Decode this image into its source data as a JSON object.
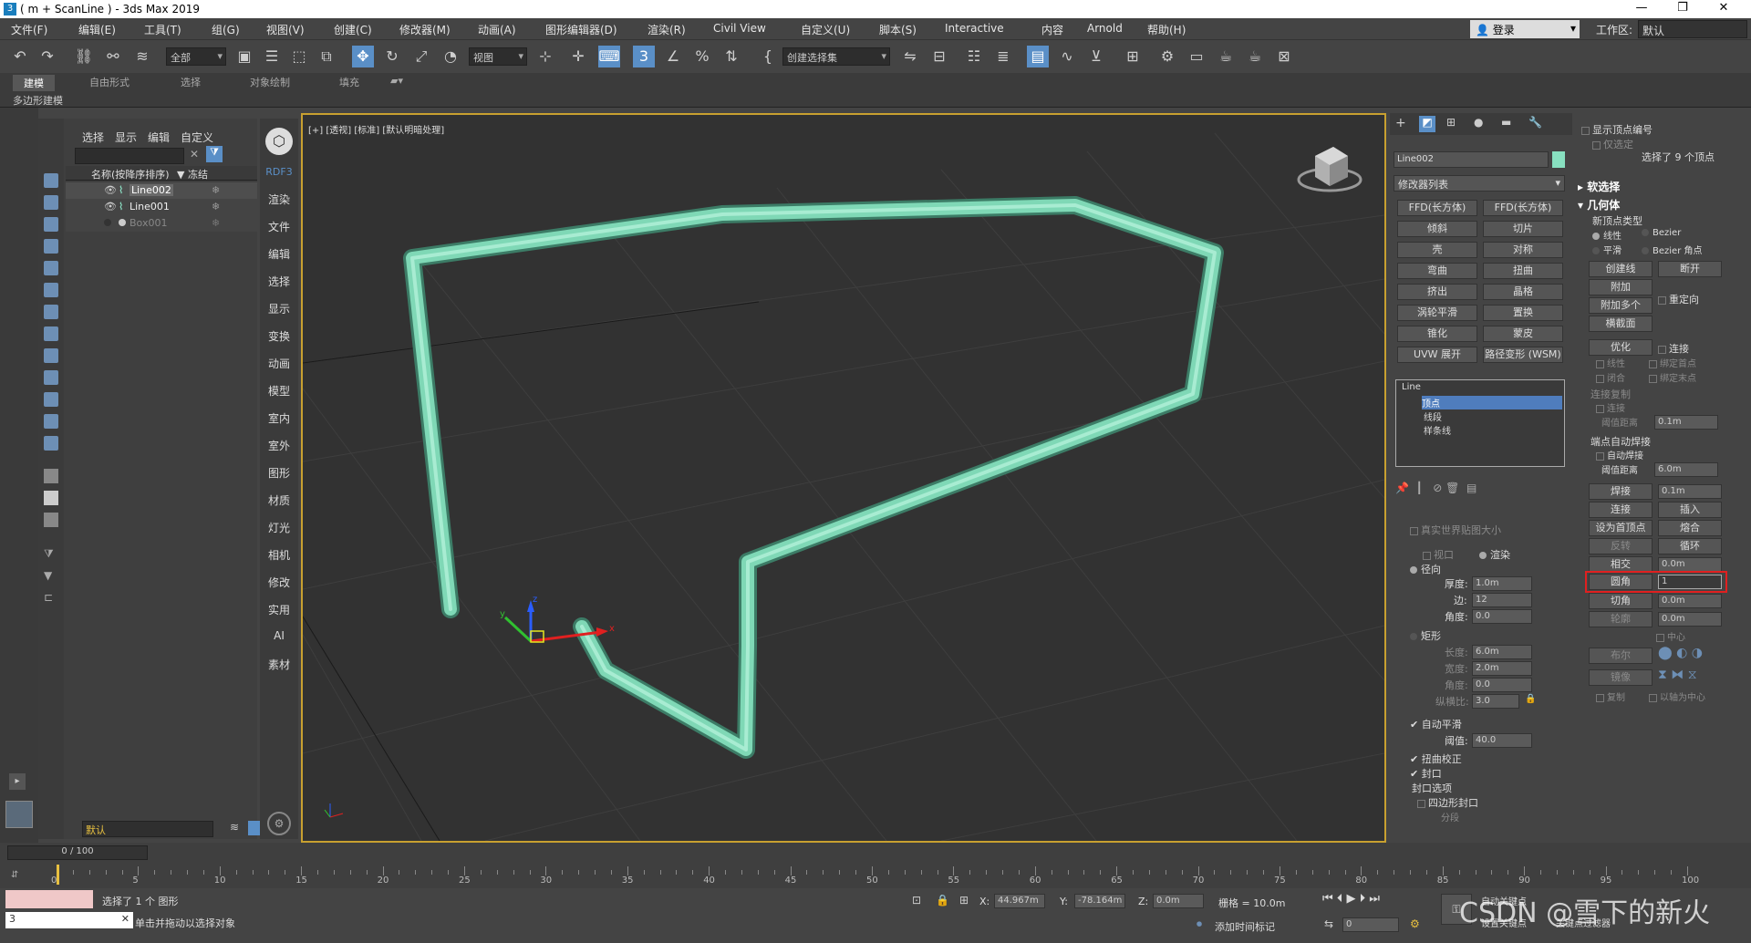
{
  "title": "( m + ScanLine ) - 3ds Max 2019",
  "menu": [
    "文件(F)",
    "编辑(E)",
    "工具(T)",
    "组(G)",
    "视图(V)",
    "创建(C)",
    "修改器(M)",
    "动画(A)",
    "图形编辑器(D)",
    "渲染(R)",
    "Civil View",
    "自定义(U)",
    "脚本(S)",
    "Interactive",
    "内容",
    "Arnold",
    "帮助(H)"
  ],
  "login": "登录",
  "workspace_label": "工作区:",
  "workspace_value": "默认",
  "toolbar": {
    "filter": "全部",
    "view": "视图",
    "selset": "创建选择集"
  },
  "ribbon": {
    "tabs": [
      "建模",
      "自由形式",
      "选择",
      "对象绘制",
      "填充"
    ],
    "sub": "多边形建模"
  },
  "scene": {
    "menus": [
      "选择",
      "显示",
      "编辑",
      "自定义"
    ],
    "col_name": "名称(按降序排序)",
    "col_freeze": "▼ 冻结",
    "items": [
      {
        "name": "Line002"
      },
      {
        "name": "Line001"
      },
      {
        "name": "Box001"
      }
    ],
    "layer": "默认"
  },
  "cmdleft": [
    "RDF3",
    "渲染",
    "文件",
    "编辑",
    "选择",
    "显示",
    "变换",
    "动画",
    "模型",
    "室内",
    "室外",
    "图形",
    "材质",
    "灯光",
    "相机",
    "修改",
    "实用",
    "AI",
    "素材"
  ],
  "viewport_label": "[+] [透视] [标准] [默认明暗处理]",
  "modify": {
    "object_name": "Line002",
    "modlist": "修改器列表",
    "buttons": [
      "FFD(长方体)",
      "FFD(长方体)",
      "倾斜",
      "切片",
      "壳",
      "对称",
      "弯曲",
      "扭曲",
      "挤出",
      "晶格",
      "涡轮平滑",
      "置换",
      "锥化",
      "蒙皮",
      "UVW 展开",
      "路径变形 (WSM)"
    ],
    "stack": [
      "Line",
      "顶点",
      "线段",
      "样条线"
    ],
    "render": {
      "real_world": "真实世界贴图大小",
      "viewport": "视口",
      "rendering": "渲染",
      "radial": "径向",
      "thick_l": "厚度:",
      "thick_v": "1.0m",
      "sides_l": "边:",
      "sides_v": "12",
      "angle_l": "角度:",
      "angle_v": "0.0",
      "rect": "矩形",
      "len_l": "长度:",
      "len_v": "6.0m",
      "wid_l": "宽度:",
      "wid_v": "2.0m",
      "ang2_l": "角度:",
      "ang2_v": "0.0",
      "asp_l": "纵横比:",
      "asp_v": "3.0",
      "autosmooth": "自动平滑",
      "thresh_l": "阈值:",
      "thresh_v": "40.0",
      "twist": "扭曲校正",
      "cap": "封口",
      "capopt": "封口选项",
      "quad": "四边形封口",
      "seg": "分段"
    }
  },
  "geom": {
    "show_vnum": "显示顶点编号",
    "sel_only": "仅选定",
    "selected": "选择了 9 个顶点",
    "soft": "软选择",
    "geom": "几何体",
    "newtype": "新顶点类型",
    "linear": "线性",
    "bezier": "Bezier",
    "smooth": "平滑",
    "bezier_corner": "Bezier 角点",
    "b1": [
      "创建线",
      "断开"
    ],
    "attach": "附加",
    "attach_multi": "附加多个",
    "reorient": "重定向",
    "cross": "横截面",
    "refine": "优化",
    "connect": "连接",
    "linear2": "线性",
    "bind_first": "绑定首点",
    "closed": "闭合",
    "bind_last": "绑定末点",
    "conn_copy": "连接复制",
    "conn": "连接",
    "thresh": "阈值距离",
    "thresh_v": "0.1m",
    "auto_weld_h": "端点自动焊接",
    "auto_weld": "自动焊接",
    "aw_thresh": "阈值距离",
    "aw_v": "6.0m",
    "weld": "焊接",
    "weld_v": "0.1m",
    "connect2": "连接",
    "insert": "插入",
    "first": "设为首顶点",
    "fuse": "熔合",
    "reverse": "反转",
    "cycle": "循环",
    "intersect": "相交",
    "intersect_v": "0.0m",
    "fillet": "圆角",
    "fillet_v": "1",
    "chamfer": "切角",
    "chamfer_v": "0.0m",
    "outline": "轮廓",
    "outline_v": "0.0m",
    "center": "中心",
    "boolean": "布尔",
    "mirror": "镜像",
    "copy": "复制",
    "about_pivot": "以轴为中心"
  },
  "timeline": {
    "range": "0 / 100",
    "ticks": [
      "0",
      "5",
      "10",
      "15",
      "20",
      "25",
      "30",
      "35",
      "40",
      "45",
      "50",
      "55",
      "60",
      "65",
      "70",
      "75",
      "80",
      "85",
      "90",
      "95",
      "100"
    ]
  },
  "status": {
    "sel": "选择了 1 个 图形",
    "hint": "单击并拖动以选择对象",
    "x_l": "X:",
    "x_v": "44.967m",
    "y_l": "Y:",
    "y_v": "-78.164m",
    "z_l": "Z:",
    "z_v": "0.0m",
    "grid": "栅格 = 10.0m",
    "addtime": "添加时间标记",
    "frame": "0",
    "setkey": "设置关键点",
    "autokey": "自动关键点",
    "keyfilter": "关键点过滤器"
  },
  "watermark": "CSDN @雪下的新火"
}
